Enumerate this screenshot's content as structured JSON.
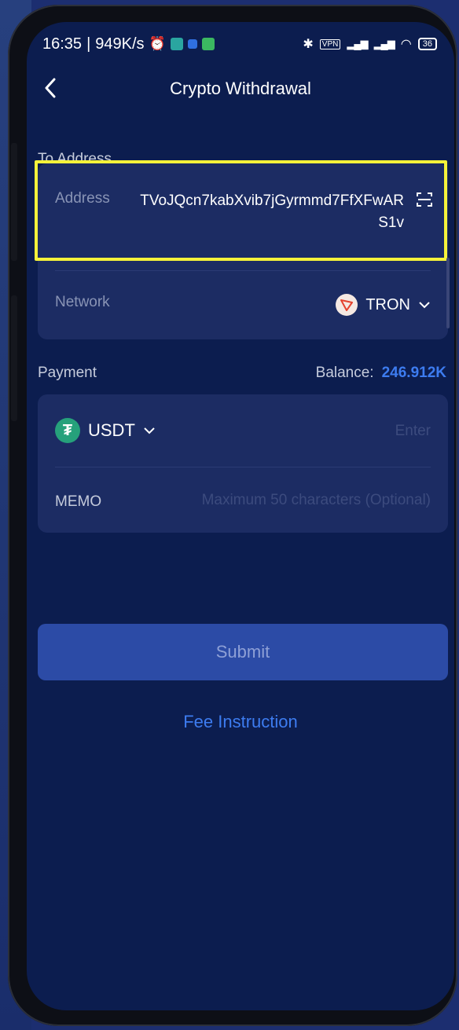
{
  "status_bar": {
    "time": "16:35",
    "speed": "949K/s",
    "battery": "36",
    "vpn": "VPN"
  },
  "header": {
    "title": "Crypto Withdrawal"
  },
  "to_address": {
    "section_label": "To Address",
    "address_label": "Address",
    "address_value": "TVoJQcn7kabXvib7jGyrmmd7FfXFwARS1v",
    "network_label": "Network",
    "network_value": "TRON"
  },
  "payment": {
    "section_label": "Payment",
    "balance_label": "Balance:",
    "balance_value": "246.912K",
    "coin": "USDT",
    "amount_placeholder": "Enter",
    "memo_label": "MEMO",
    "memo_placeholder": "Maximum 50 characters (Optional)"
  },
  "actions": {
    "submit_label": "Submit",
    "fee_link": "Fee Instruction"
  },
  "colors": {
    "accent": "#3d7cf0",
    "highlight": "#f5f23a",
    "tether": "#26a17b"
  }
}
